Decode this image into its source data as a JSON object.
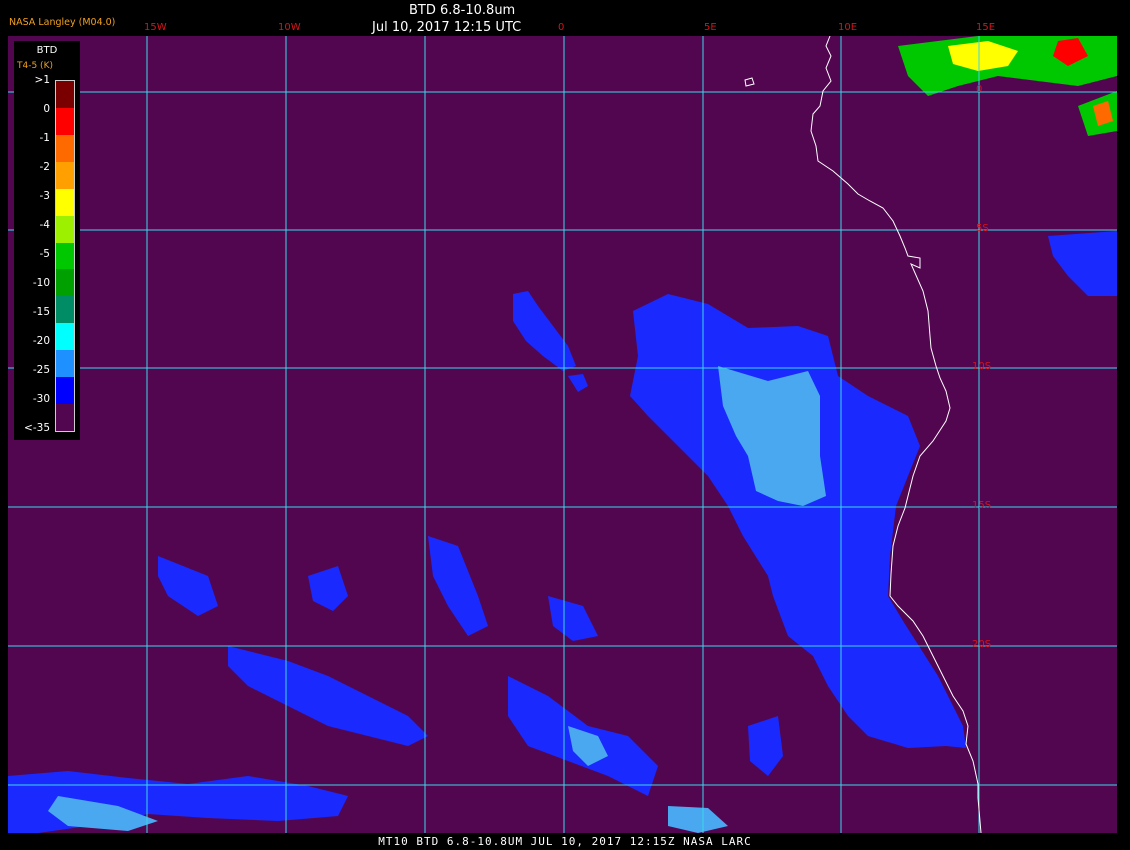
{
  "header": {
    "title": "BTD 6.8-10.8um",
    "datetime": "Jul 10, 2017 12:15 UTC",
    "agency": "NASA Langley (M04.0)"
  },
  "longitude_labels": [
    "15W",
    "10W",
    "0",
    "5E",
    "10E",
    "15E"
  ],
  "latitude_labels": [
    "0",
    "5S",
    "10S",
    "15S",
    "20S"
  ],
  "legend": {
    "title": "BTD",
    "subtitle": "T4-5 (K)",
    "ticks": [
      ">1",
      "0",
      "-1",
      "-2",
      "-3",
      "-4",
      "-5",
      "-10",
      "-15",
      "-20",
      "-25",
      "-30",
      "<-35"
    ],
    "colors": [
      "#7a0000",
      "#ff0000",
      "#ff6a00",
      "#ffa000",
      "#ffff00",
      "#9cf000",
      "#00c800",
      "#00a000",
      "#008c64",
      "#00ffff",
      "#1e90ff",
      "#0000ff",
      "#520650"
    ]
  },
  "colors": {
    "background": "#520650",
    "grid": "#38d8e8",
    "coastline": "#ffffff",
    "cloud_deep": "#1a2aff",
    "cloud_light": "#4aa8f0"
  },
  "footer": "MT10  BTD 6.8-10.8UM   JUL 10, 2017 12:15Z   NASA LARC"
}
